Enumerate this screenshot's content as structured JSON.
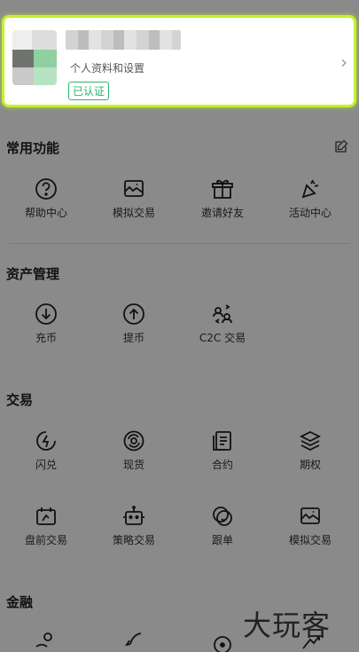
{
  "profile": {
    "subtitle": "个人资料和设置",
    "badge": "已认证"
  },
  "sections": {
    "common": "常用功能",
    "assets": "资产管理",
    "trade": "交易",
    "finance": "金融"
  },
  "common_items": [
    "帮助中心",
    "模拟交易",
    "邀请好友",
    "活动中心"
  ],
  "asset_items": [
    "充币",
    "提币",
    "C2C 交易"
  ],
  "trade_items": [
    "闪兑",
    "现货",
    "合约",
    "期权",
    "盘前交易",
    "策略交易",
    "跟单",
    "模拟交易"
  ],
  "watermark": "大玩客"
}
